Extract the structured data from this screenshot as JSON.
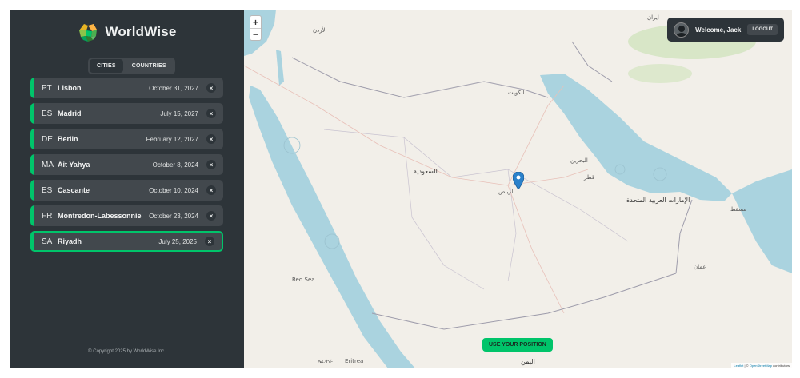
{
  "app": {
    "logo_text": "WorldWise",
    "copyright": "© Copyright 2025 by WorldWise Inc."
  },
  "tabs": [
    {
      "label": "CITIES",
      "active": true
    },
    {
      "label": "COUNTRIES",
      "active": false
    }
  ],
  "cities": [
    {
      "code": "PT",
      "name": "Lisbon",
      "date": "October 31, 2027",
      "active": false
    },
    {
      "code": "ES",
      "name": "Madrid",
      "date": "July 15, 2027",
      "active": false
    },
    {
      "code": "DE",
      "name": "Berlin",
      "date": "February 12, 2027",
      "active": false
    },
    {
      "code": "MA",
      "name": "Ait Yahya",
      "date": "October 8, 2024",
      "active": false
    },
    {
      "code": "ES",
      "name": "Cascante",
      "date": "October 10, 2024",
      "active": false
    },
    {
      "code": "FR",
      "name": "Montredon-Labessonnie",
      "date": "October 23, 2024",
      "active": false
    },
    {
      "code": "SA",
      "name": "Riyadh",
      "date": "July 25, 2025",
      "active": true
    }
  ],
  "delete_glyph": "×",
  "map": {
    "zoom_in": "+",
    "zoom_out": "−",
    "welcome": "Welcome, Jack",
    "logout": "LOGOUT",
    "use_position": "USE YOUR POSITION",
    "attribution_leaflet": "Leaflet",
    "attribution_sep": " | © ",
    "attribution_osm": "OpenStreetMap",
    "attribution_tail": " contributors",
    "labels": {
      "saudi": "السعودية",
      "riyadh": "الرياض",
      "kuwait": "الكويت",
      "bahrain": "البحرين",
      "qatar": "قطر",
      "uae": "الإمارات العربية المتحدة",
      "oman": "عمان",
      "yemen": "اليمن",
      "iran": "ایران",
      "jordan": "الأردن",
      "muscat": "مسقط",
      "eritrea": "Eritrea",
      "redsea": "Red Sea",
      "eritrea_local": "ኤርትራ"
    }
  },
  "colors": {
    "accent": "#00c46a",
    "sidebar_bg": "#2d3439",
    "item_bg": "#42484d",
    "water": "#aad3df",
    "land": "#f2efe9"
  }
}
